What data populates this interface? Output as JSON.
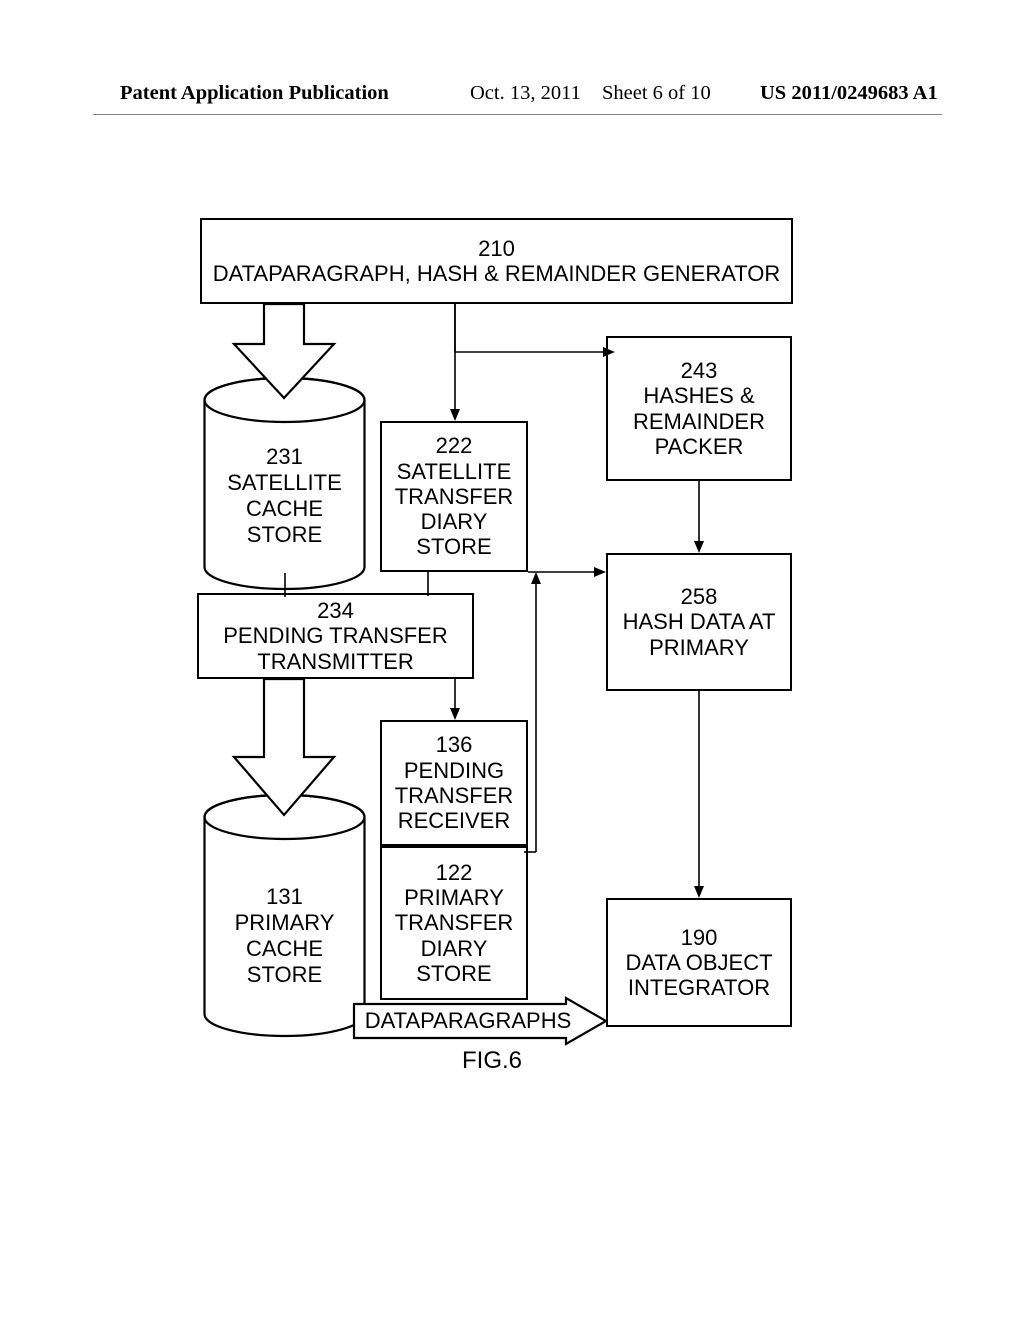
{
  "header": {
    "left": "Patent Application Publication",
    "date": "Oct. 13, 2011",
    "sheet": "Sheet 6 of 10",
    "right": "US 2011/0249683 A1"
  },
  "boxes": {
    "b210": {
      "ref": "210",
      "label": "DATAPARAGRAPH, HASH & REMAINDER  GENERATOR"
    },
    "b243": {
      "ref": "243",
      "label": "HASHES & REMAINDER PACKER"
    },
    "b222": {
      "ref": "222",
      "label": "SATELLITE TRANSFER DIARY STORE"
    },
    "b258": {
      "ref": "258",
      "label": "HASH DATA AT PRIMARY"
    },
    "b234": {
      "ref": "234",
      "label": "PENDING TRANSFER TRANSMITTER"
    },
    "b136": {
      "ref": "136",
      "label": "PENDING TRANSFER RECEIVER"
    },
    "b122": {
      "ref": "122",
      "label": "PRIMARY TRANSFER DIARY STORE"
    },
    "b190": {
      "ref": "190",
      "label": "DATA OBJECT INTEGRATOR"
    }
  },
  "cylinders": {
    "c231": {
      "ref": "231",
      "label": "SATELLITE CACHE STORE"
    },
    "c131": {
      "ref": "131",
      "label": "PRIMARY CACHE STORE"
    }
  },
  "arrows": {
    "dataparagraphs_label": "DATAPARAGRAPHS"
  },
  "figure_caption": "FIG.6"
}
